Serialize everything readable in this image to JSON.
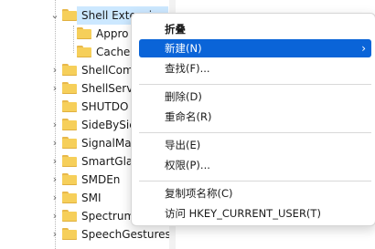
{
  "tree": {
    "items": [
      {
        "label": "Shell Extensions",
        "selected": true,
        "expanded": true
      },
      {
        "label": "Appro"
      },
      {
        "label": "Cache"
      },
      {
        "label": "ShellCom"
      },
      {
        "label": "ShellServ"
      },
      {
        "label": "SHUTDO"
      },
      {
        "label": "SideBySic"
      },
      {
        "label": "SignalMa"
      },
      {
        "label": "SmartGla"
      },
      {
        "label": "SMDEn"
      },
      {
        "label": "SMI"
      },
      {
        "label": "Spectrum"
      },
      {
        "label": "SpeechGestures"
      }
    ]
  },
  "context_menu": {
    "collapse": "折叠",
    "new": "新建(N)",
    "find": "查找(F)...",
    "delete": "删除(D)",
    "rename": "重命名(R)",
    "export": "导出(E)",
    "permissions": "权限(P)...",
    "copy_key_name": "复制项名称(C)",
    "goto": "访问 HKEY_CURRENT_USER(T)"
  },
  "colors": {
    "highlight": "#0a64d8",
    "selection": "#cce8ff",
    "folder": "#f6cf5a"
  }
}
